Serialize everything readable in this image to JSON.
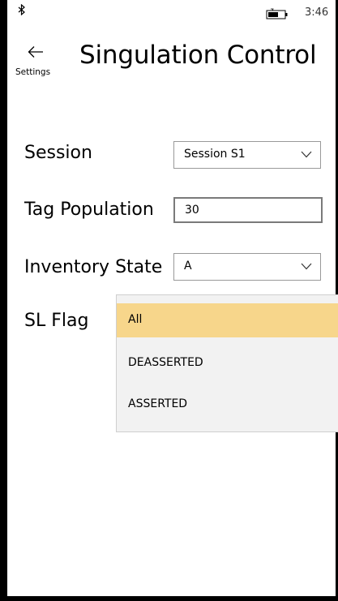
{
  "status_bar": {
    "time": "3:46",
    "icons": [
      "bluetooth-icon",
      "battery-icon"
    ]
  },
  "header": {
    "back_label": "Settings",
    "back_icon": "back-arrow-icon",
    "title": "Singulation Control"
  },
  "form": {
    "session": {
      "label": "Session",
      "value": "Session S1"
    },
    "tag_population": {
      "label": "Tag Population",
      "value": "30"
    },
    "inventory_state": {
      "label": "Inventory State",
      "value": "A"
    },
    "sl_flag": {
      "label": "SL Flag",
      "options": [
        "All",
        "DEASSERTED",
        "ASSERTED"
      ],
      "selected": "All"
    }
  },
  "colors": {
    "selected_highlight": "#f7d68b",
    "dropdown_bg": "#f2f2f2"
  }
}
